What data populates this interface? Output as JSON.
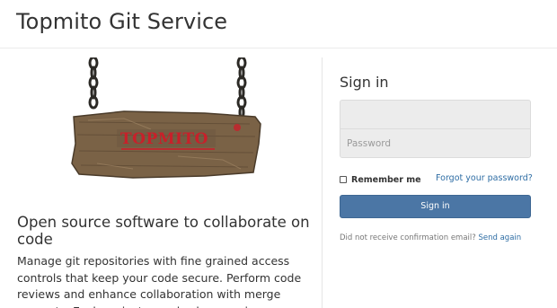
{
  "header": {
    "title": "Topmito Git Service"
  },
  "logo": {
    "text": "TOPMITO"
  },
  "main": {
    "headline": "Open source software to collaborate on code",
    "description": "Manage git repositories with fine grained access controls that keep your code secure. Perform code reviews and enhance collaboration with merge requests. Each project can also have an issue tracker"
  },
  "signin": {
    "title": "Sign in",
    "login_placeholder": "",
    "password_placeholder": "Password",
    "remember_label": "Remember me",
    "forgot_link": "Forgot your password?",
    "button_label": "Sign in",
    "confirm_text": "Did not receive confirmation email?",
    "confirm_link": "Send again"
  },
  "colors": {
    "primary_button": "#4b76a5",
    "link": "#2e6da4",
    "input_bg": "#ececec",
    "logo_red": "#c8202a"
  }
}
